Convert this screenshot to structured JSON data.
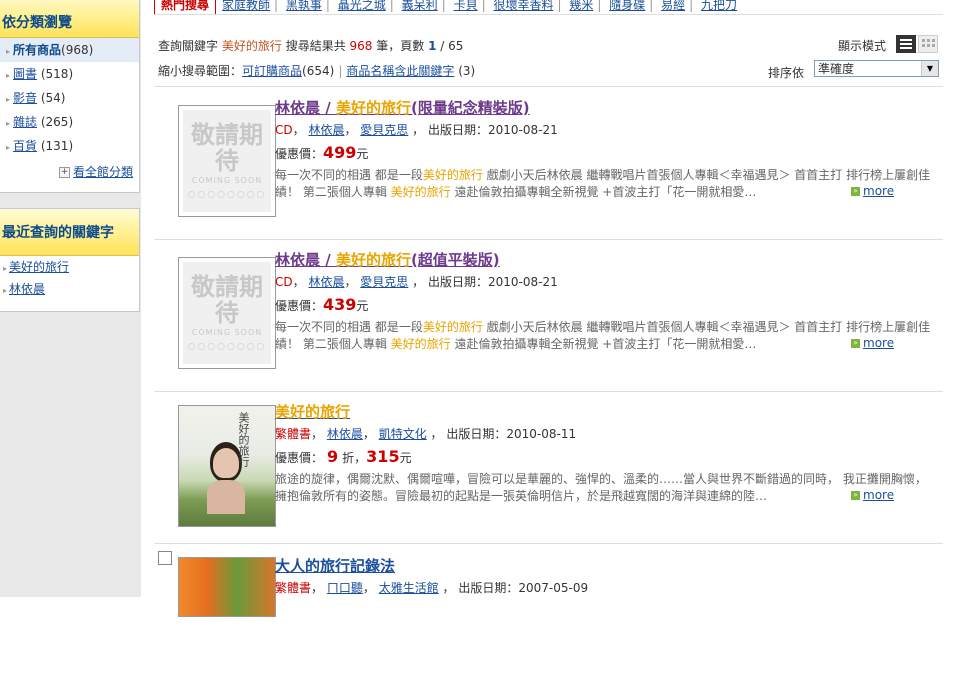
{
  "sidebar": {
    "categories_title": "依分類瀏覽",
    "all_label": "所有商品",
    "all_count": "(968)",
    "items": [
      {
        "label": "圖書",
        "count": "(518)"
      },
      {
        "label": "影音",
        "count": "(54)"
      },
      {
        "label": "雜誌",
        "count": "(265)"
      },
      {
        "label": "百貨",
        "count": "(131)"
      }
    ],
    "see_all": "看全館分類",
    "recent_title": "最近查詢的關鍵字",
    "recent": [
      "美好的旅行",
      "林依晨"
    ]
  },
  "toplinks": {
    "hot": "熱門搜尋",
    "links": [
      "家庭教師",
      "黑執事",
      "聶光之城",
      "義呆利",
      "卡貝",
      "很壞幸香料",
      "幾米",
      "隨身碟",
      "易經",
      "九把刀"
    ]
  },
  "search": {
    "prefix": "查詢關鍵字",
    "keyword": "美好的旅行",
    "results_mid": "搜尋結果共",
    "total": "968",
    "results_unit": "筆，頁數",
    "page": "1",
    "pages": "/ 65",
    "narrow_label": "縮小搜尋範圍：",
    "narrow1": "可訂購商品",
    "narrow1_count": "(654)",
    "narrow2": "商品名稱含此關鍵字",
    "narrow2_count": "(3)",
    "display_mode": "顯示模式",
    "sort_label": "排序依",
    "sort_value": "準確度"
  },
  "items": [
    {
      "title_pre": "林依晨 / ",
      "title_hl": "美好的旅行",
      "title_post": "(限量紀念精裝版)",
      "type": "CD",
      "author": "林依晨",
      "publisher": "愛貝克思",
      "date_label": "出版日期：",
      "date": "2010-08-21",
      "price_label": "優惠價：",
      "price": "499",
      "currency": "元",
      "placeholder": "敬請期待",
      "placeholder_sub": "COMING SOON",
      "placeholder_sub2": "○○○○○○○○",
      "desc_a": "每一次不同的相遇 都是一段",
      "desc_b": " 戲劇小天后林依晨 繼轉戰唱片首張個人專輯＜幸福遇見＞ 首首主打 排行榜上屢創佳績！ 第二張個人專輯 ",
      "desc_c": " 遠赴倫敦拍攝專輯全新視覺 +首波主打「花一開就相愛…",
      "desc_hl": "美好的旅行",
      "more": "more"
    },
    {
      "title_pre": "林依晨 / ",
      "title_hl": "美好的旅行",
      "title_post": "(超值平裝版)",
      "type": "CD",
      "author": "林依晨",
      "publisher": "愛貝克思",
      "date_label": "出版日期：",
      "date": "2010-08-21",
      "price_label": "優惠價：",
      "price": "439",
      "currency": "元",
      "placeholder": "敬請期待",
      "placeholder_sub": "COMING SOON",
      "placeholder_sub2": "○○○○○○○○",
      "desc_a": "每一次不同的相遇 都是一段",
      "desc_b": " 戲劇小天后林依晨 繼轉戰唱片首張個人專輯＜幸福遇見＞ 首首主打 排行榜上屢創佳績！ 第二張個人專輯 ",
      "desc_c": " 遠赴倫敦拍攝專輯全新視覺 +首波主打「花一開就相愛…",
      "desc_hl": "美好的旅行",
      "more": "more"
    },
    {
      "title_hl": "美好的旅行",
      "type": "繁體書",
      "author": "林依晨",
      "publisher": "凱特文化",
      "date_label": "出版日期：",
      "date": "2010-08-11",
      "price_label": "優惠價：",
      "discount": "9",
      "discount_unit": "折，",
      "price": "315",
      "currency": "元",
      "cover_text": "美好的旅行",
      "desc": "旅途的旋律，偶爾沈默、偶爾喧嘩，冒險可以是華麗的、強悍的、溫柔的……當人與世界不斷錯過的同時， 我正攤開胸懷，擁抱倫敦所有的姿態。冒險最初的起點是一張英倫明信片，於是飛越寬闊的海洋與連綿的陸…",
      "more": "more"
    },
    {
      "title": "大人的旅行記錄法",
      "type": "繁體書",
      "author": "ㄇ口聽",
      "publisher": "太雅生活館",
      "date_label": "出版日期：",
      "date": "2007-05-09"
    }
  ],
  "colors": {
    "accent": "#c00000",
    "link": "#1b4f9c",
    "highlight": "#e8a400",
    "header_yellow": "#ffe257"
  }
}
